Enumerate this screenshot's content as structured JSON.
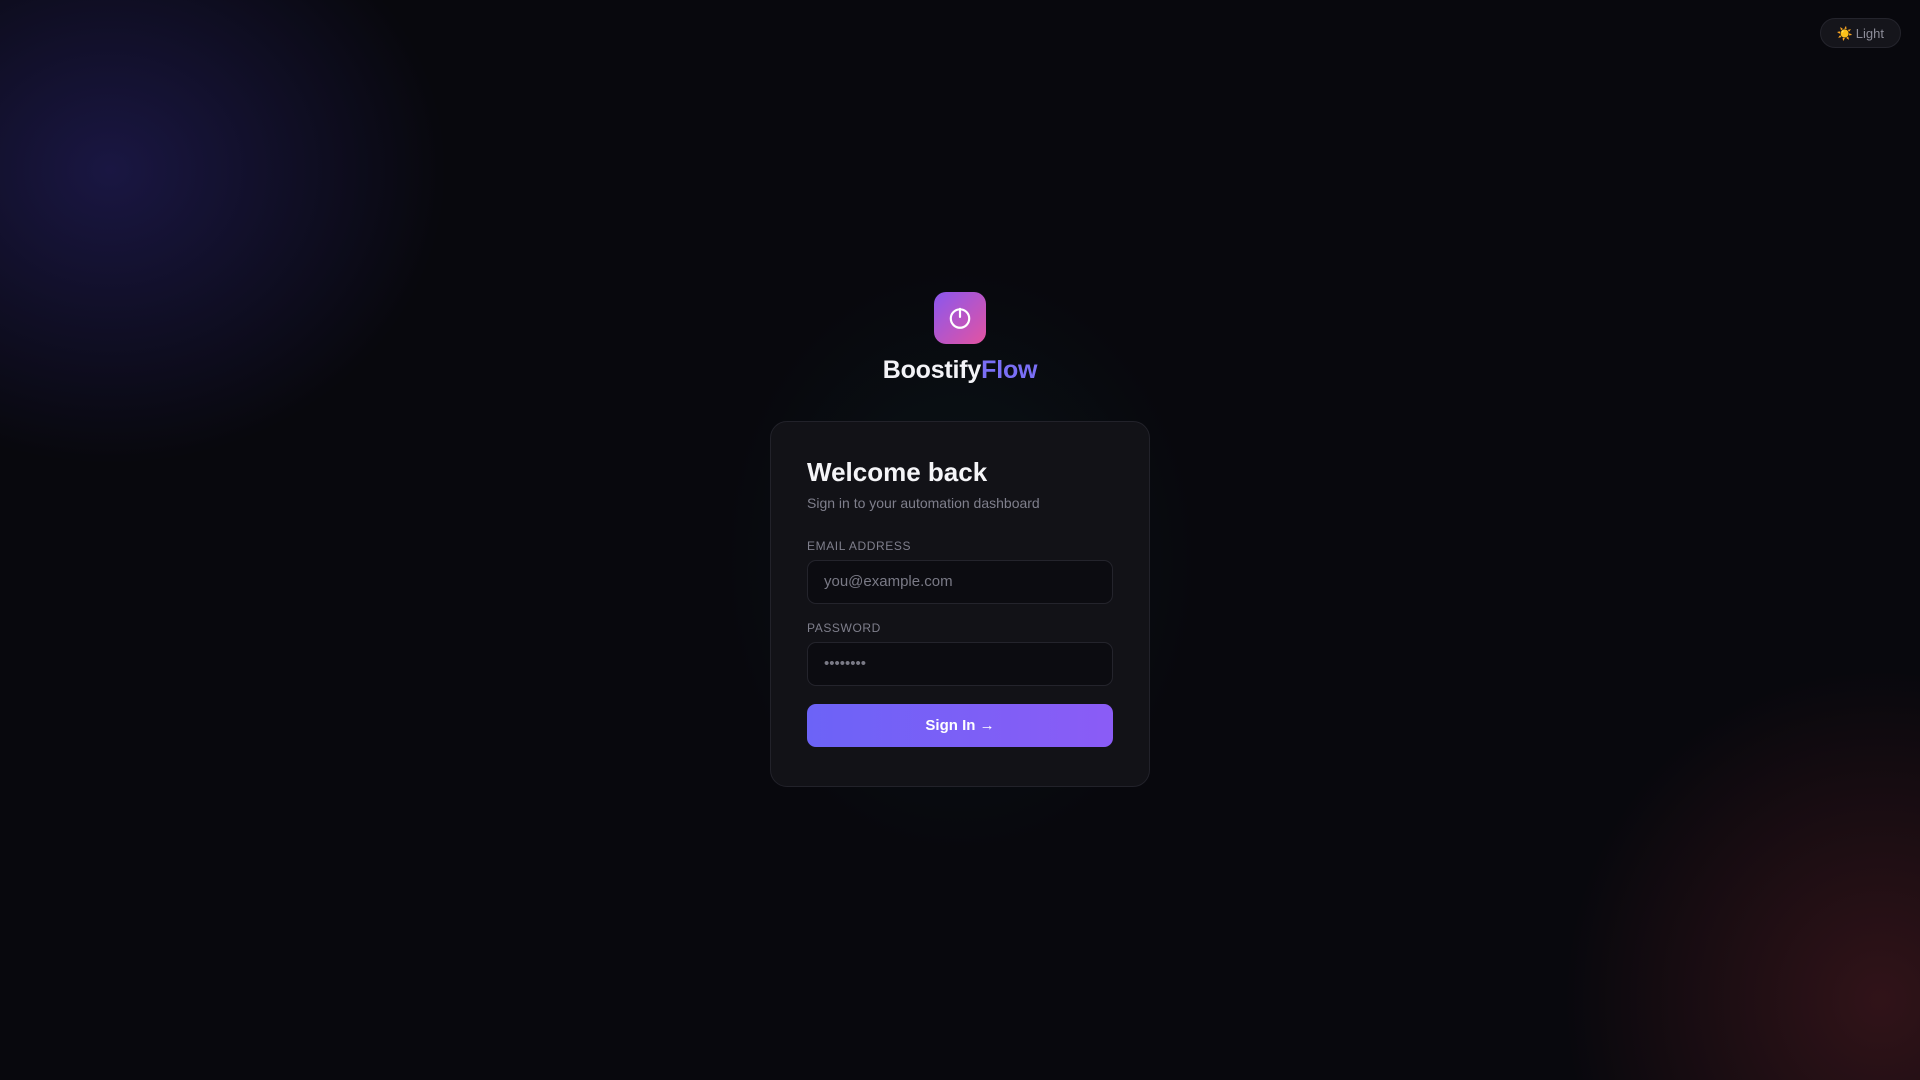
{
  "theme_toggle": {
    "icon": "sun-icon",
    "icon_glyph": "☀️",
    "label": "Light"
  },
  "brand": {
    "logo_icon": "power-icon",
    "name_primary": "Boostify",
    "name_accent": "Flow",
    "gradient_colors": [
      "#8a57ee",
      "#e353a1"
    ],
    "accent_color": "#7a6ff5"
  },
  "login": {
    "title": "Welcome back",
    "subtitle": "Sign in to your automation dashboard",
    "email": {
      "label": "EMAIL ADDRESS",
      "placeholder": "you@example.com",
      "value": ""
    },
    "password": {
      "label": "PASSWORD",
      "placeholder": "••••••••",
      "value": ""
    },
    "submit_label": "Sign In →",
    "button_colors": [
      "#6c63f7",
      "#8b5cf6"
    ]
  }
}
